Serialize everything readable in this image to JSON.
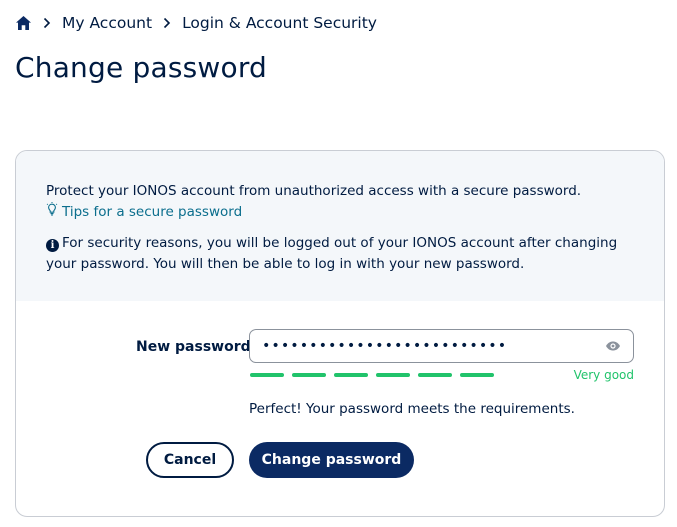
{
  "breadcrumb": {
    "items": [
      {
        "label": "My Account"
      },
      {
        "label": "Login & Account Security"
      }
    ]
  },
  "page": {
    "title": "Change password"
  },
  "info": {
    "intro": "Protect your IONOS account from unauthorized access with a secure password.",
    "tips_link": "Tips for a secure password",
    "notice": "For security reasons, you will be logged out of your IONOS account after changing your password. You will then be able to log in with your new password."
  },
  "form": {
    "new_password_label": "New password",
    "new_password_value": "••••••••••••••••••••••••••",
    "strength_label": "Very good",
    "strength_level": 1.0,
    "requirements_message": "Perfect! Your password meets the requirements.",
    "cancel_label": "Cancel",
    "submit_label": "Change password"
  },
  "icons": {
    "home": "home-icon",
    "chevron": "chevron-right-icon",
    "lightbulb": "lightbulb-icon",
    "info": "info-icon",
    "eye": "eye-icon"
  },
  "colors": {
    "primary": "#001b41",
    "button": "#0b2a63",
    "link": "#0b6e8d",
    "success": "#21c36b",
    "panel": "#f4f7fa"
  }
}
